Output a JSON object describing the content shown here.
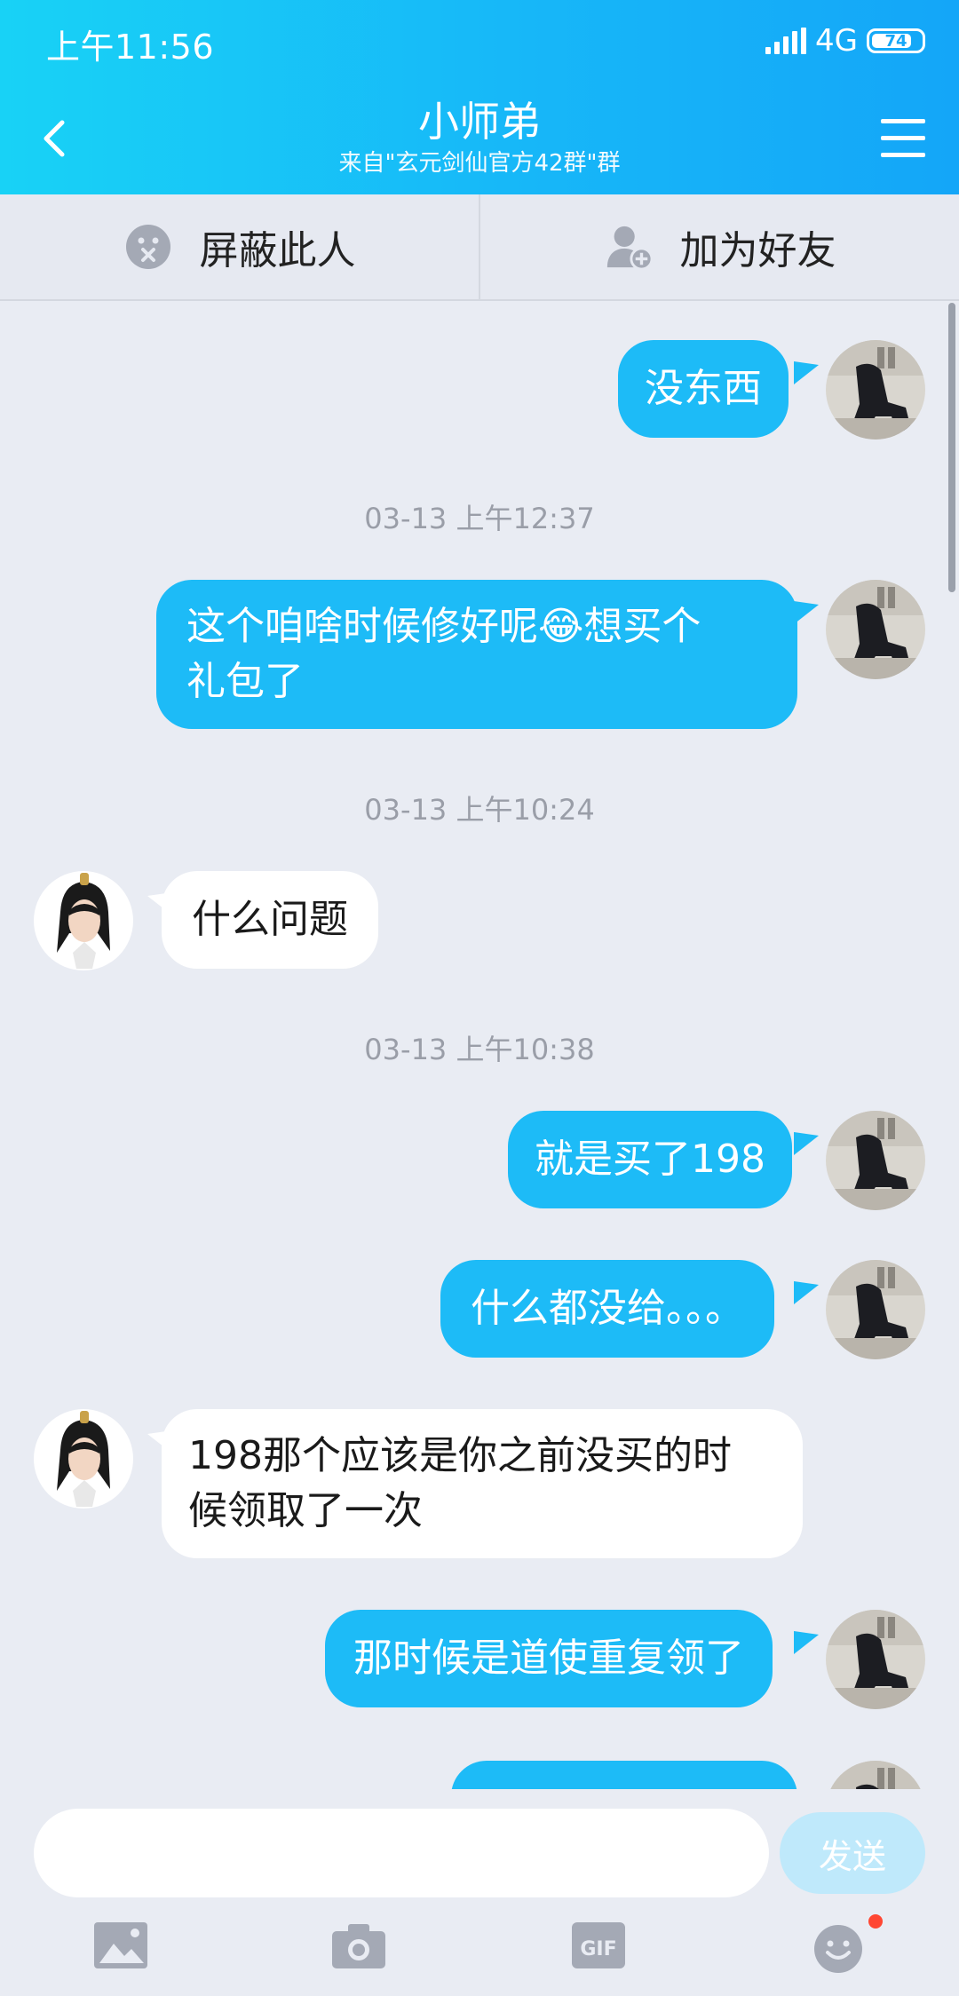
{
  "status_bar": {
    "time": "上午11:56",
    "network": "4G",
    "battery": "74",
    "battery_level": 0.74
  },
  "header": {
    "title": "小师弟",
    "subtitle": "来自\"玄元剑仙官方42群\"群"
  },
  "actions": {
    "block": "屏蔽此人",
    "add_friend": "加为好友"
  },
  "messages": {
    "m1": "没东西",
    "t1": "03-13 上午12:37",
    "m2_line1": "这个咱啥时候修好呢",
    "m2_emoji": "😂",
    "m2_line1b": "想买个",
    "m2_line2": "礼包了",
    "t2": "03-13 上午10:24",
    "m3": "什么问题",
    "t3": "03-13 上午10:38",
    "m4": "就是买了198",
    "m5": "什么都没给。。。",
    "m6_line1": "198那个应该是你之前没买的时",
    "m6_line2": "候领取了一次",
    "m7": "那时候是道使重复领了"
  },
  "input": {
    "placeholder": "",
    "send_label": "发送"
  },
  "toolbar": {
    "icons": [
      "image-icon",
      "camera-icon",
      "gif-icon",
      "emoji-icon"
    ],
    "gif_label": "GIF"
  },
  "colors": {
    "header_start": "#18d2f6",
    "header_end": "#14a6f8",
    "outgoing_bubble": "#1dbbf7",
    "incoming_bubble": "#ffffff",
    "send_button": "#bfe9fb",
    "background": "#e9ecf3",
    "notification_dot": "#ff4733"
  }
}
